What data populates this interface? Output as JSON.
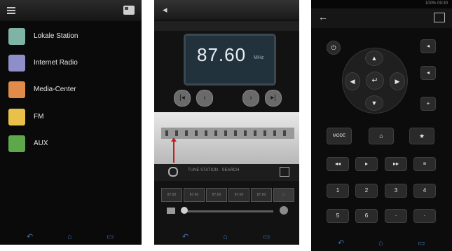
{
  "phone1": {
    "sources": [
      {
        "label": "Lokale Station",
        "icon": "local-station-icon",
        "color": "#7fb3a6"
      },
      {
        "label": "Internet Radio",
        "icon": "internet-radio-icon",
        "color": "#8e8ec8"
      },
      {
        "label": "Media-Center",
        "icon": "media-center-icon",
        "color": "#e08b4a"
      },
      {
        "label": "FM",
        "icon": "fm-icon",
        "color": "#e8c04a"
      },
      {
        "label": "AUX",
        "icon": "aux-icon",
        "color": "#5ca84a"
      }
    ]
  },
  "phone2": {
    "frequency": "87.60",
    "unit": "MHz",
    "station_text": "TUNE STATION · SEARCH",
    "presets": [
      "87.60",
      "87.60",
      "87.60",
      "87.60",
      "87.60"
    ]
  },
  "phone3": {
    "status_text": "100%  09:30",
    "mode_label": "MODE",
    "numbers": [
      "1",
      "2",
      "3",
      "4",
      "5",
      "6"
    ]
  },
  "colors": {
    "accent_blue": "#3f6fa8",
    "display_bg": "#22323c",
    "needle": "#c02020"
  }
}
